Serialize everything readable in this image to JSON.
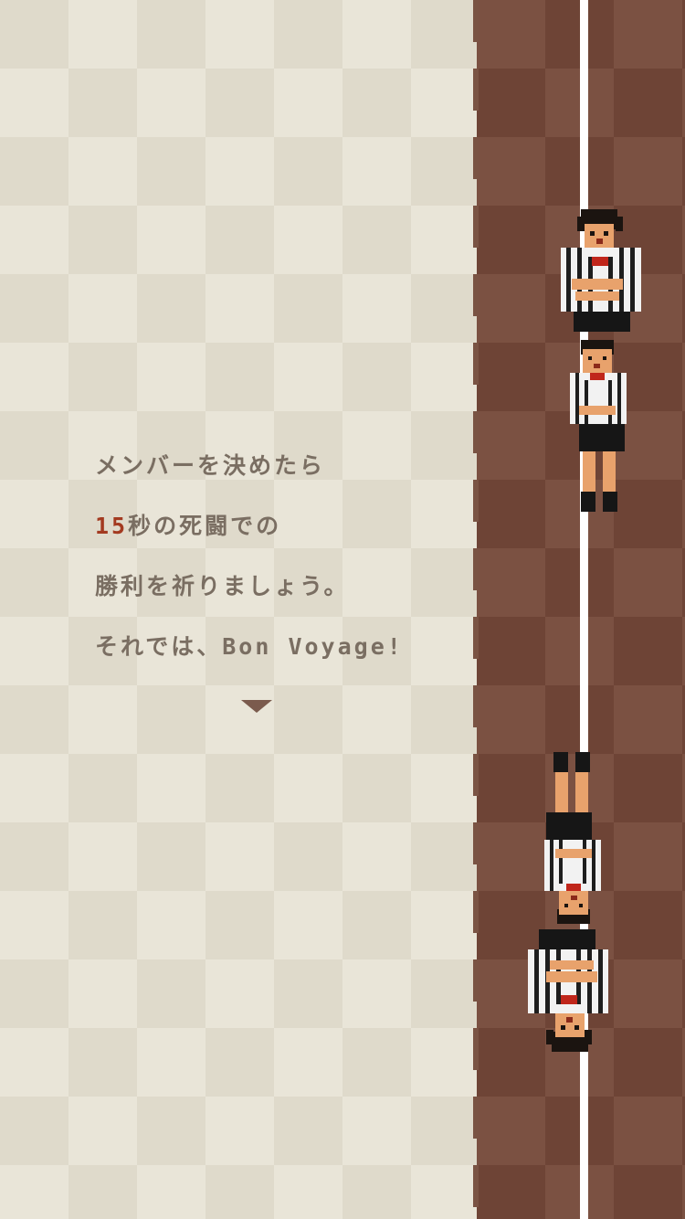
{
  "dialog": {
    "line1": "メンバーを決めたら",
    "line2_number": "15",
    "line2_rest": "秒の死闘での",
    "line3": "勝利を祈りましょう。",
    "line4": "それでは、Bon Voyage!",
    "next_indicator": "triangle-down-icon"
  },
  "colors": {
    "floor_light": "#e9e5d8",
    "floor_light_alt": "#dfdacb",
    "floor_dark": "#6e4436",
    "floor_dark_alt": "#7b5142",
    "text": "#7a6e62",
    "highlight": "#a33a20",
    "court_line": "#ffffff"
  },
  "players": [
    {
      "role": "team-top-front",
      "sprite": "striped-referee-player"
    },
    {
      "role": "team-top-back",
      "sprite": "striped-referee-player"
    },
    {
      "role": "team-bottom-front",
      "sprite": "striped-referee-player"
    },
    {
      "role": "team-bottom-back",
      "sprite": "striped-referee-player"
    }
  ]
}
